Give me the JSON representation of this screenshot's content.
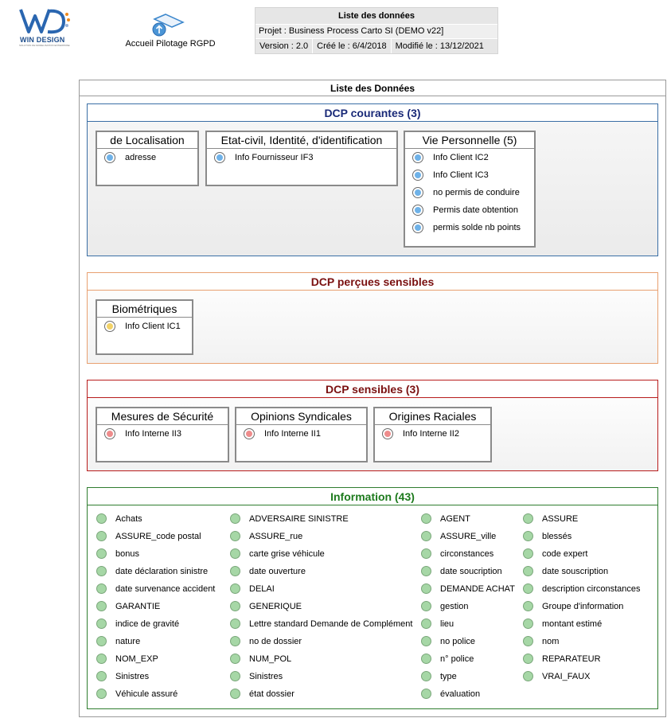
{
  "header": {
    "logo_text": "WIN DESIGN",
    "logo_sub": "SOLUTION DE MODELISATION ENTERPRISE",
    "home_link": "Accueil Pilotage RGPD",
    "info": {
      "title": "Liste des données",
      "project": "Projet : Business Process Carto SI (DEMO v22]",
      "version": "Version : 2.0",
      "created": "Créé le : 6/4/2018",
      "modified": "Modifié le : 13/12/2021"
    }
  },
  "panel": {
    "title": "Liste des Données",
    "sections": {
      "courantes": {
        "title": "DCP courantes (3)",
        "groups": [
          {
            "title": "de Localisation",
            "items": [
              "adresse"
            ]
          },
          {
            "title": "Etat-civil, Identité, d'identification",
            "items": [
              "Info Fournisseur IF3"
            ]
          },
          {
            "title": "Vie Personnelle (5)",
            "items": [
              "Info Client IC2",
              "Info Client IC3",
              "no permis de conduire",
              "Permis date obtention",
              "permis solde nb points"
            ]
          }
        ]
      },
      "percues": {
        "title": "DCP perçues sensibles",
        "groups": [
          {
            "title": "Biométriques",
            "items": [
              "Info Client IC1"
            ]
          }
        ]
      },
      "sensibles": {
        "title": "DCP sensibles (3)",
        "groups": [
          {
            "title": "Mesures de Sécurité",
            "items": [
              "Info Interne II3"
            ]
          },
          {
            "title": "Opinions Syndicales",
            "items": [
              "Info Interne II1"
            ]
          },
          {
            "title": "Origines Raciales",
            "items": [
              "Info Interne II2"
            ]
          }
        ]
      },
      "information": {
        "title": "Information (43)",
        "columns": [
          [
            "Achats",
            "ASSURE_code postal",
            "bonus",
            "date déclaration sinistre",
            "date survenance accident",
            "GARANTIE",
            "indice de gravité",
            "nature",
            "NOM_EXP",
            "Sinistres",
            "Véhicule assuré"
          ],
          [
            "ADVERSAIRE SINISTRE",
            "ASSURE_rue",
            "carte grise véhicule",
            "date ouverture",
            "DELAI",
            "GENERIQUE",
            "Lettre standard Demande de Complément",
            "no de dossier",
            "NUM_POL",
            "Sinistres",
            "état dossier"
          ],
          [
            "AGENT",
            "ASSURE_ville",
            "circonstances",
            "date soucription",
            "DEMANDE ACHAT",
            "gestion",
            "lieu",
            "no police",
            "n° police",
            "type",
            "évaluation"
          ],
          [
            "ASSURE",
            "blessés",
            "code expert",
            "date souscription",
            "description circonstances",
            "Groupe d'information",
            "montant estimé",
            "nom",
            "REPARATEUR",
            "VRAI_FAUX"
          ]
        ]
      }
    }
  }
}
